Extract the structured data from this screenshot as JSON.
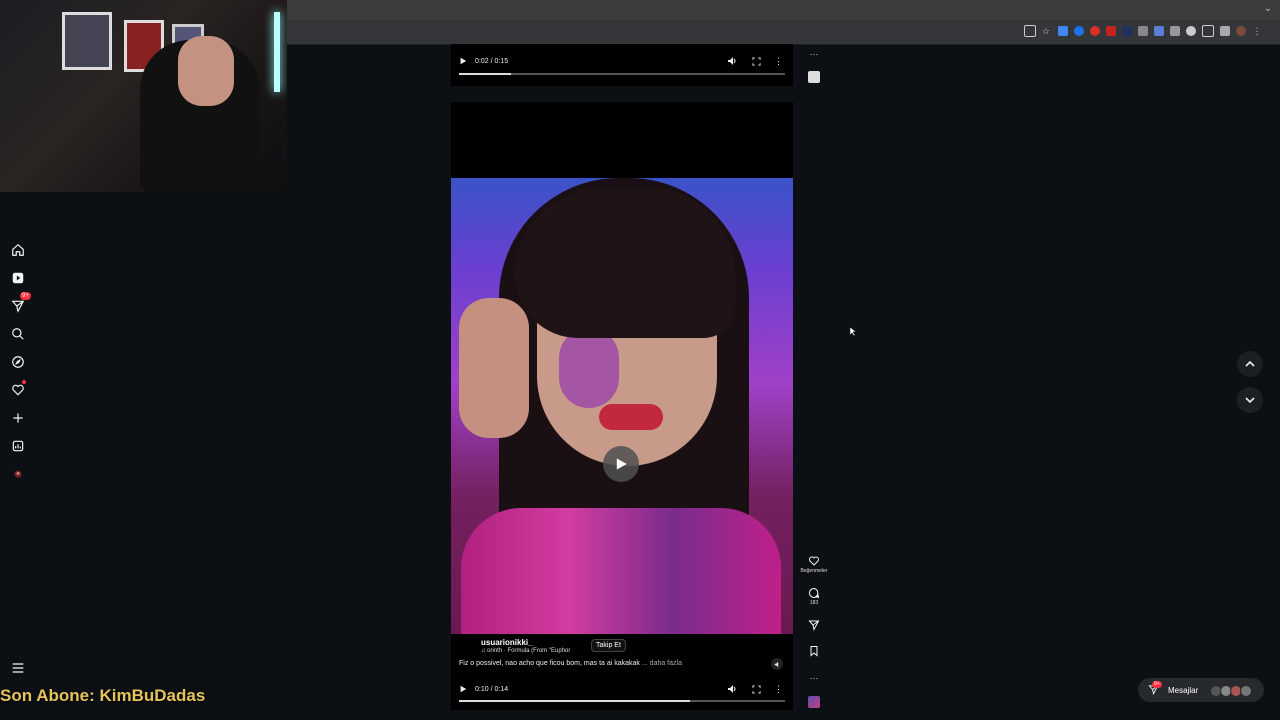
{
  "overlay": {
    "stream_text": "Son Abone: KimBuDadas"
  },
  "sidebar": {
    "notifications_badge": "9+",
    "items": [
      {
        "name": "home"
      },
      {
        "name": "reels"
      },
      {
        "name": "messages"
      },
      {
        "name": "search"
      },
      {
        "name": "explore"
      },
      {
        "name": "notifications"
      },
      {
        "name": "create"
      },
      {
        "name": "dashboard"
      },
      {
        "name": "profile"
      }
    ]
  },
  "post1": {
    "time": "0:02 / 0:15",
    "progress": 0.16
  },
  "post2": {
    "username": "usuarionikki_",
    "music": "orinth · Formula (From \"Euphor",
    "follow_label": "Takip Et",
    "caption": "Fiz o possivel, nao acho que ficou bom, mas ta ai kakakak",
    "more_label": "... daha fazla",
    "time": "0:10 / 0:14",
    "progress": 0.71
  },
  "actions": {
    "likes_label": "Beğenmeler",
    "comments_count": "183",
    "more_top": "···",
    "more_bottom": "···"
  },
  "messages": {
    "label": "Mesajlar",
    "badge": "9+"
  },
  "colors": {
    "accent_red": "#ff3040",
    "overlay_text": "#e6c35a",
    "background": "#0c1014"
  }
}
